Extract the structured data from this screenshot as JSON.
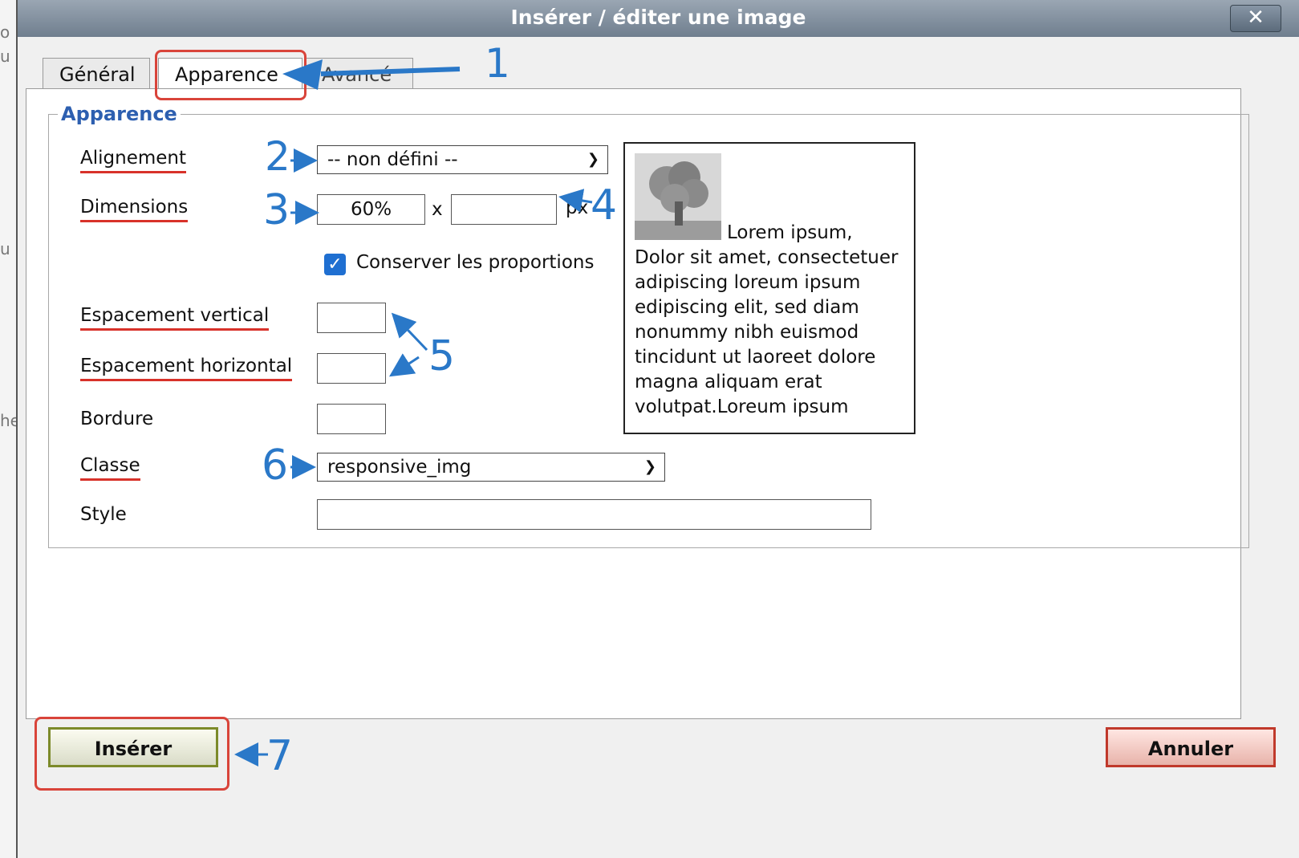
{
  "background": {
    "fragments": [
      "o",
      "u",
      "u",
      "he"
    ]
  },
  "dialog": {
    "title": "Insérer / éditer une image",
    "close_label": "✕"
  },
  "tabs": [
    {
      "label": "Général",
      "active": false
    },
    {
      "label": "Apparence",
      "active": true
    },
    {
      "label": "Avancé",
      "active": false
    }
  ],
  "fieldset": {
    "legend": "Apparence",
    "alignment": {
      "label": "Alignement",
      "value": "-- non défini --"
    },
    "dimensions": {
      "label": "Dimensions",
      "width": "60%",
      "separator": "x",
      "height": "",
      "unit": "px"
    },
    "keep_proportions": {
      "label": "Conserver les proportions",
      "checked": true
    },
    "vspace": {
      "label": "Espacement vertical",
      "value": ""
    },
    "hspace": {
      "label": "Espacement horizontal",
      "value": ""
    },
    "border": {
      "label": "Bordure",
      "value": ""
    },
    "class": {
      "label": "Classe",
      "value": "responsive_img"
    },
    "style": {
      "label": "Style",
      "value": ""
    }
  },
  "preview": {
    "text": "Lorem ipsum, Dolor sit amet, consectetuer adipiscing loreum ipsum edipiscing elit, sed diam nonummy nibh euismod tincidunt ut laoreet dolore magna aliquam erat volutpat.Loreum ipsum"
  },
  "buttons": {
    "insert": "Insérer",
    "cancel": "Annuler"
  },
  "annotations": {
    "n1": "1",
    "n2": "2",
    "n3": "3",
    "n4": "4",
    "n5": "5",
    "n6": "6",
    "n7": "7"
  },
  "colors": {
    "annotation": "#2a78c8",
    "highlight": "#d9443a",
    "legend": "#2d5fb0"
  }
}
